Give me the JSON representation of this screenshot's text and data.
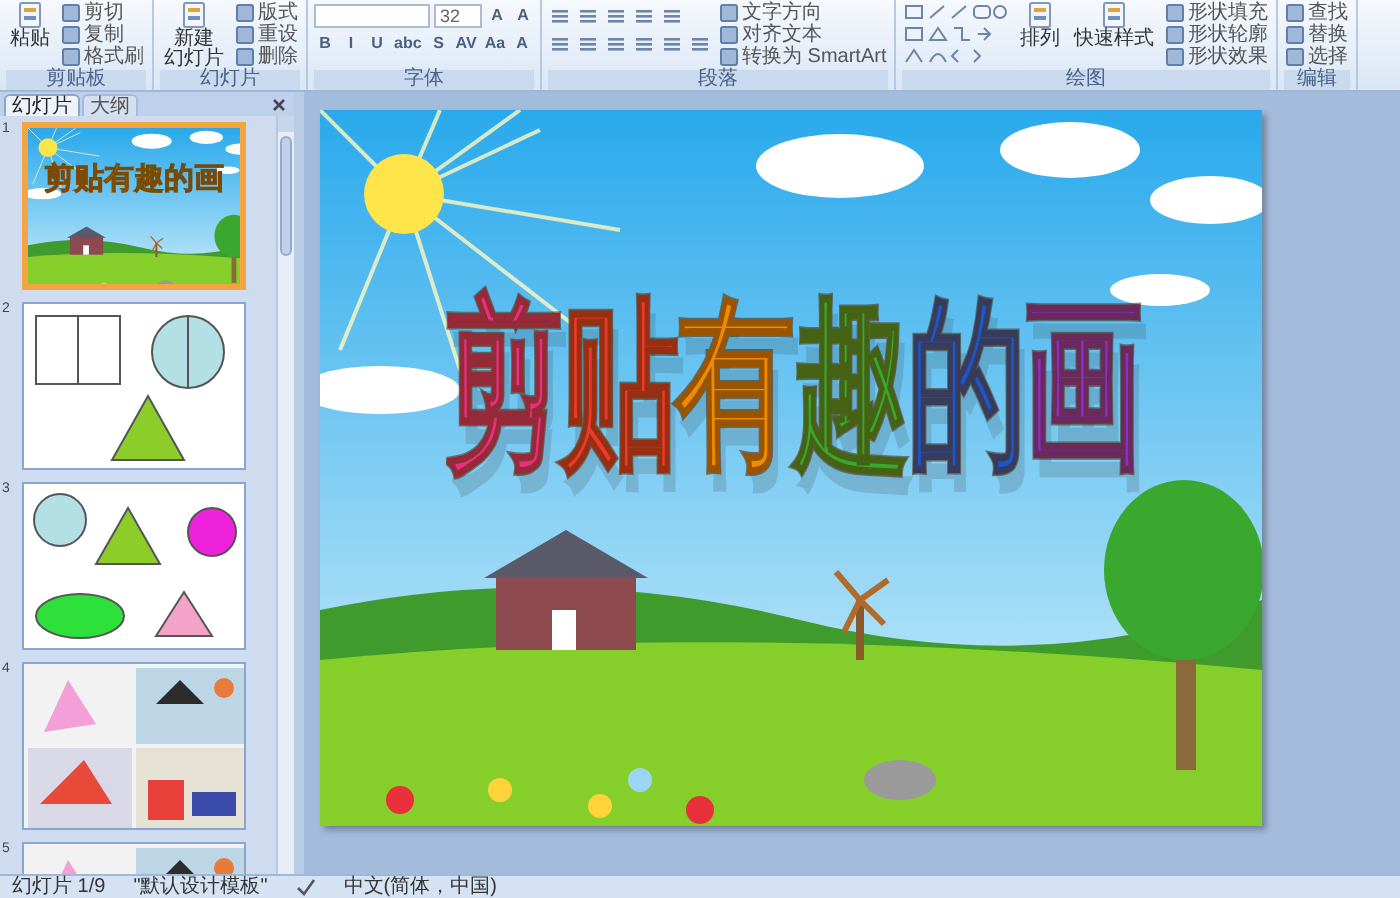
{
  "ribbon": {
    "groups": [
      {
        "label": "剪贴板",
        "columns": [
          [
            {
              "kind": "large",
              "label": "粘贴"
            }
          ],
          [
            {
              "kind": "small",
              "label": "剪切"
            },
            {
              "kind": "small",
              "label": "复制"
            },
            {
              "kind": "small",
              "label": "格式刷"
            }
          ]
        ]
      },
      {
        "label": "幻灯片",
        "columns": [
          [
            {
              "kind": "large",
              "lines": [
                "新建",
                "幻灯片"
              ]
            }
          ],
          [
            {
              "kind": "small",
              "label": "版式"
            },
            {
              "kind": "small",
              "label": "重设"
            },
            {
              "kind": "small",
              "label": "删除"
            }
          ]
        ]
      },
      {
        "label": "字体",
        "columns": [
          [
            {
              "kind": "row",
              "items": [
                {
                  "kind": "field"
                },
                {
                  "kind": "field",
                  "label": "32"
                },
                {
                  "kind": "glyph",
                  "label": "A"
                },
                {
                  "kind": "glyph",
                  "label": "A"
                }
              ]
            },
            {
              "kind": "row",
              "items": [
                {
                  "kind": "glyph",
                  "label": "B"
                },
                {
                  "kind": "glyph",
                  "label": "I"
                },
                {
                  "kind": "glyph",
                  "label": "U"
                },
                {
                  "kind": "glyph",
                  "label": "abc"
                },
                {
                  "kind": "glyph",
                  "label": "S"
                },
                {
                  "kind": "glyph",
                  "label": "AV"
                },
                {
                  "kind": "glyph",
                  "label": "Aa"
                },
                {
                  "kind": "glyph",
                  "label": "A"
                }
              ]
            }
          ]
        ]
      },
      {
        "label": "段落",
        "columns": [
          [
            {
              "kind": "row",
              "items": [
                {
                  "kind": "icon"
                },
                {
                  "kind": "icon"
                },
                {
                  "kind": "icon"
                },
                {
                  "kind": "icon"
                },
                {
                  "kind": "icon"
                }
              ]
            },
            {
              "kind": "row",
              "items": [
                {
                  "kind": "icon"
                },
                {
                  "kind": "icon"
                },
                {
                  "kind": "icon"
                },
                {
                  "kind": "icon"
                },
                {
                  "kind": "icon"
                },
                {
                  "kind": "icon"
                }
              ]
            }
          ],
          [
            {
              "kind": "small",
              "label": "文字方向"
            },
            {
              "kind": "small",
              "label": "对齐文本"
            },
            {
              "kind": "small",
              "label": "转换为 SmartArt"
            }
          ]
        ]
      },
      {
        "label": "绘图",
        "columns": [
          [
            {
              "kind": "gallery"
            }
          ],
          [
            {
              "kind": "large",
              "label": "排列"
            }
          ],
          [
            {
              "kind": "large",
              "label": "快速样式"
            }
          ],
          [
            {
              "kind": "small",
              "label": "形状填充"
            },
            {
              "kind": "small",
              "label": "形状轮廓"
            },
            {
              "kind": "small",
              "label": "形状效果"
            }
          ]
        ]
      },
      {
        "label": "编辑",
        "columns": [
          [
            {
              "kind": "small",
              "label": "查找"
            },
            {
              "kind": "small",
              "label": "替换"
            },
            {
              "kind": "small",
              "label": "选择"
            }
          ]
        ]
      }
    ]
  },
  "panel": {
    "tabs": [
      {
        "label": "幻灯片",
        "selected": true
      },
      {
        "label": "大纲",
        "selected": false
      }
    ],
    "slides": [
      {
        "number": "1",
        "selected": true,
        "kind": "title",
        "title": "剪贴有趣的画"
      },
      {
        "number": "2",
        "selected": false,
        "kind": "shapes_a"
      },
      {
        "number": "3",
        "selected": false,
        "kind": "shapes_b"
      },
      {
        "number": "4",
        "selected": false,
        "kind": "picture"
      },
      {
        "number": "5",
        "selected": false,
        "kind": "picture"
      }
    ]
  },
  "slide": {
    "title": [
      {
        "text": "剪",
        "color": "#e8307f"
      },
      {
        "text": "贴",
        "color": "#ee3a2a"
      },
      {
        "text": "有",
        "color": "#f08a00"
      },
      {
        "text": "趣",
        "color": "#3aa82f"
      },
      {
        "text": "的",
        "color": "#1c56c8"
      },
      {
        "text": "画",
        "color": "#8b2fc9"
      }
    ]
  },
  "status_bar": [
    "幻灯片 1/9",
    "\"默认设计模板\"",
    "中文(简体，中国)"
  ]
}
